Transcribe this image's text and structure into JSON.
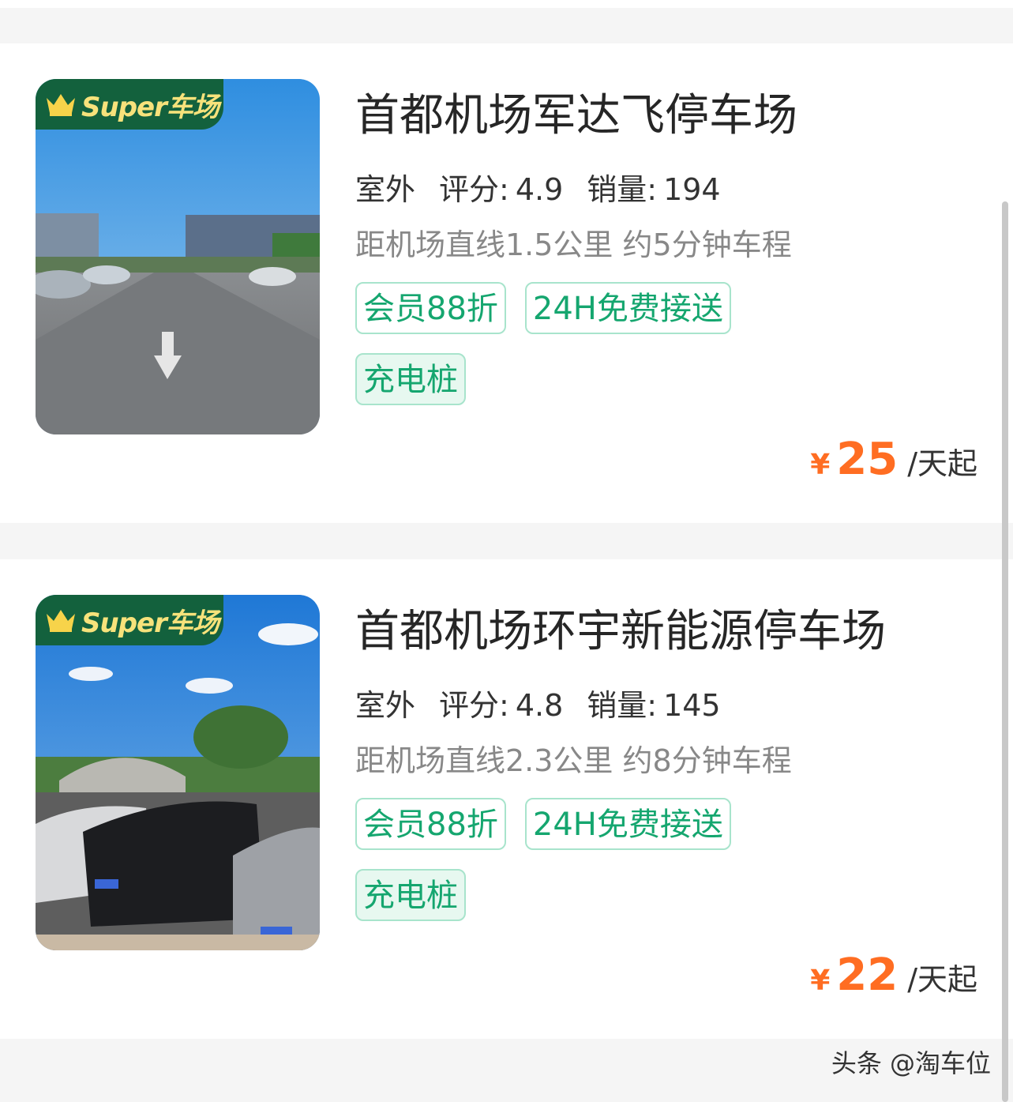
{
  "listings": [
    {
      "badge": "Super车场",
      "name": "首都机场军达飞停车场",
      "environment": "室外",
      "rating_label": "评分:",
      "rating": "4.9",
      "sales_label": "销量:",
      "sales": "194",
      "distance": "距机场直线1.5公里 约5分钟车程",
      "tags": [
        "会员88折",
        "24H免费接送",
        "充电桩"
      ],
      "currency": "¥",
      "price": "25",
      "price_unit": "/天起"
    },
    {
      "badge": "Super车场",
      "name": "首都机场环宇新能源停车场",
      "environment": "室外",
      "rating_label": "评分:",
      "rating": "4.8",
      "sales_label": "销量:",
      "sales": "145",
      "distance": "距机场直线2.3公里 约8分钟车程",
      "tags": [
        "会员88折",
        "24H免费接送",
        "充电桩"
      ],
      "currency": "¥",
      "price": "22",
      "price_unit": "/天起"
    }
  ],
  "watermark": "头条 @淘车位",
  "colors": {
    "price": "#ff6d22",
    "tag_text": "#15a66f",
    "tag_border": "#a8e4cc",
    "badge_bg": "#13613d",
    "badge_text": "#f7e27b"
  }
}
